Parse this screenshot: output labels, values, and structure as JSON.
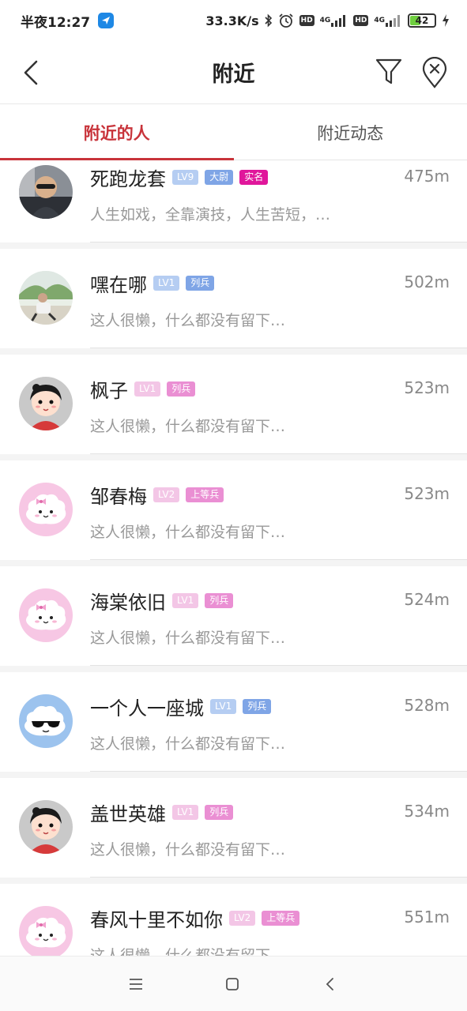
{
  "status_bar": {
    "time": "半夜12:27",
    "net_speed": "33.3K/s",
    "battery": "42",
    "net_type_1": "4G",
    "net_type_2": "4G",
    "hd_1": "HD",
    "hd_2": "HD"
  },
  "header": {
    "title": "附近"
  },
  "tabs": [
    {
      "label": "附近的人",
      "active": true
    },
    {
      "label": "附近动态",
      "active": false
    }
  ],
  "users": [
    {
      "name": "死跑龙套",
      "badges": [
        "LV9",
        "大尉",
        "实名"
      ],
      "distance": "475m",
      "bio": "人生如戏，全靠演技，人生苦短，…",
      "avatar": "photo-man-sunglasses-icon"
    },
    {
      "name": "嘿在哪",
      "badges": [
        "LV1",
        "列兵"
      ],
      "distance": "502m",
      "bio": "这人很懒，什么都没有留下…",
      "avatar": "photo-outdoor-icon"
    },
    {
      "name": "枫子",
      "badges": [
        "LV1",
        "列兵"
      ],
      "distance": "523m",
      "bio": "这人很懒，什么都没有留下…",
      "avatar": "cartoon-girl-icon"
    },
    {
      "name": "邹春梅",
      "badges": [
        "LV2",
        "上等兵"
      ],
      "distance": "523m",
      "bio": "这人很懒，什么都没有留下…",
      "avatar": "cloud-pink-bow-icon"
    },
    {
      "name": "海棠依旧",
      "badges": [
        "LV1",
        "列兵"
      ],
      "distance": "524m",
      "bio": "这人很懒，什么都没有留下…",
      "avatar": "cloud-pink-bow-icon"
    },
    {
      "name": "一个人一座城",
      "badges": [
        "LV1",
        "列兵"
      ],
      "distance": "528m",
      "bio": "这人很懒，什么都没有留下…",
      "avatar": "cloud-sunglasses-icon"
    },
    {
      "name": "盖世英雄",
      "badges": [
        "LV1",
        "列兵"
      ],
      "distance": "534m",
      "bio": "这人很懒，什么都没有留下…",
      "avatar": "cartoon-girl-icon"
    },
    {
      "name": "春风十里不如你",
      "badges": [
        "LV2",
        "上等兵"
      ],
      "distance": "551m",
      "bio": "这人很懒，什么都没有留下…",
      "avatar": "cloud-pink-bow-icon"
    }
  ],
  "colors": {
    "accent": "#c8333a",
    "badge_lv_blue": "#b5cdf2",
    "badge_rank_blue": "#7fa5e6",
    "badge_lv_pink": "#f3c6e6",
    "badge_rank_pink": "#ea8fd3",
    "badge_verified": "#e0179b"
  }
}
